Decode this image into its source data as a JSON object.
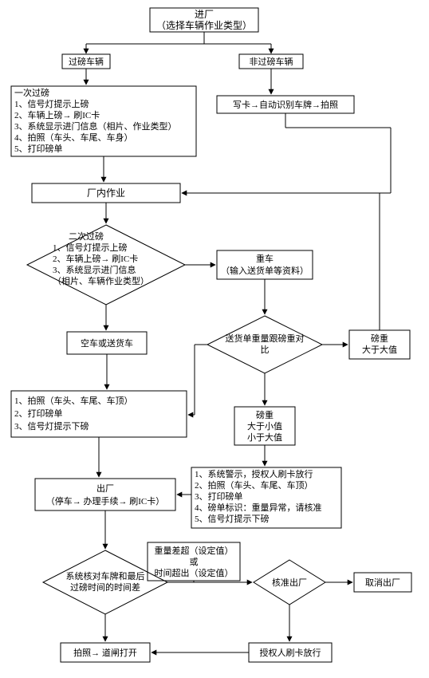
{
  "title": "进厂",
  "title_sub": "（选择车辆作业类型）",
  "branch_left": "过磅车辆",
  "branch_right": "非过磅车辆",
  "first_weigh_header": "一次过磅",
  "first_weigh_lines": [
    "1、信号灯提示上磅",
    "2、车辆上磅→ 刷IC卡",
    "3、系统显示进门信息（相片、作业类型）",
    "4、拍照（车头、车尾、车身）",
    "5、打印磅单"
  ],
  "nonweigh_line": "写卡→自动识别车牌→拍照",
  "inplant": "厂内作业",
  "second_weigh_header": "二次过磅",
  "second_weigh_lines": [
    "1、信号灯提示上磅",
    "2、车辆上磅→ 刷IC卡",
    "3、系统显示进门信息",
    "（相片、车辆作业类型）"
  ],
  "heavy_vehicle": "重车",
  "heavy_vehicle_sub": "（输入送货单等资料）",
  "empty_or_delivery": "空车或送货车",
  "compare": "送货单重量跟磅重对比",
  "gt_large": "磅重\n大于大值",
  "mid_range": "磅重\n大于小值\n小于大值",
  "photo_print_lines": [
    "1、拍照（车头、车尾、车顶）",
    "2、打印磅单",
    "3、信号灯提示下磅"
  ],
  "alert_lines": [
    "1、系统警示，授权人刷卡放行",
    "2、拍照（车头、车尾、车顶）",
    "3、打印磅单",
    "4、磅单标识：重量异常，请核准",
    "5、信号灯提示下磅"
  ],
  "exit_title": "出厂",
  "exit_sub": "（停车→ 办理手续→ 刷IC卡）",
  "sys_check": "系统核对车牌和最后过磅时间的时间差",
  "over_label": "重量差超（设定值）\n或\n时间超出（设定值）",
  "approve_exit": "核准出厂",
  "cancel_exit": "取消出厂",
  "gate_open": "拍照→ 道闸打开",
  "auth_swipe": "授权人刷卡放行"
}
